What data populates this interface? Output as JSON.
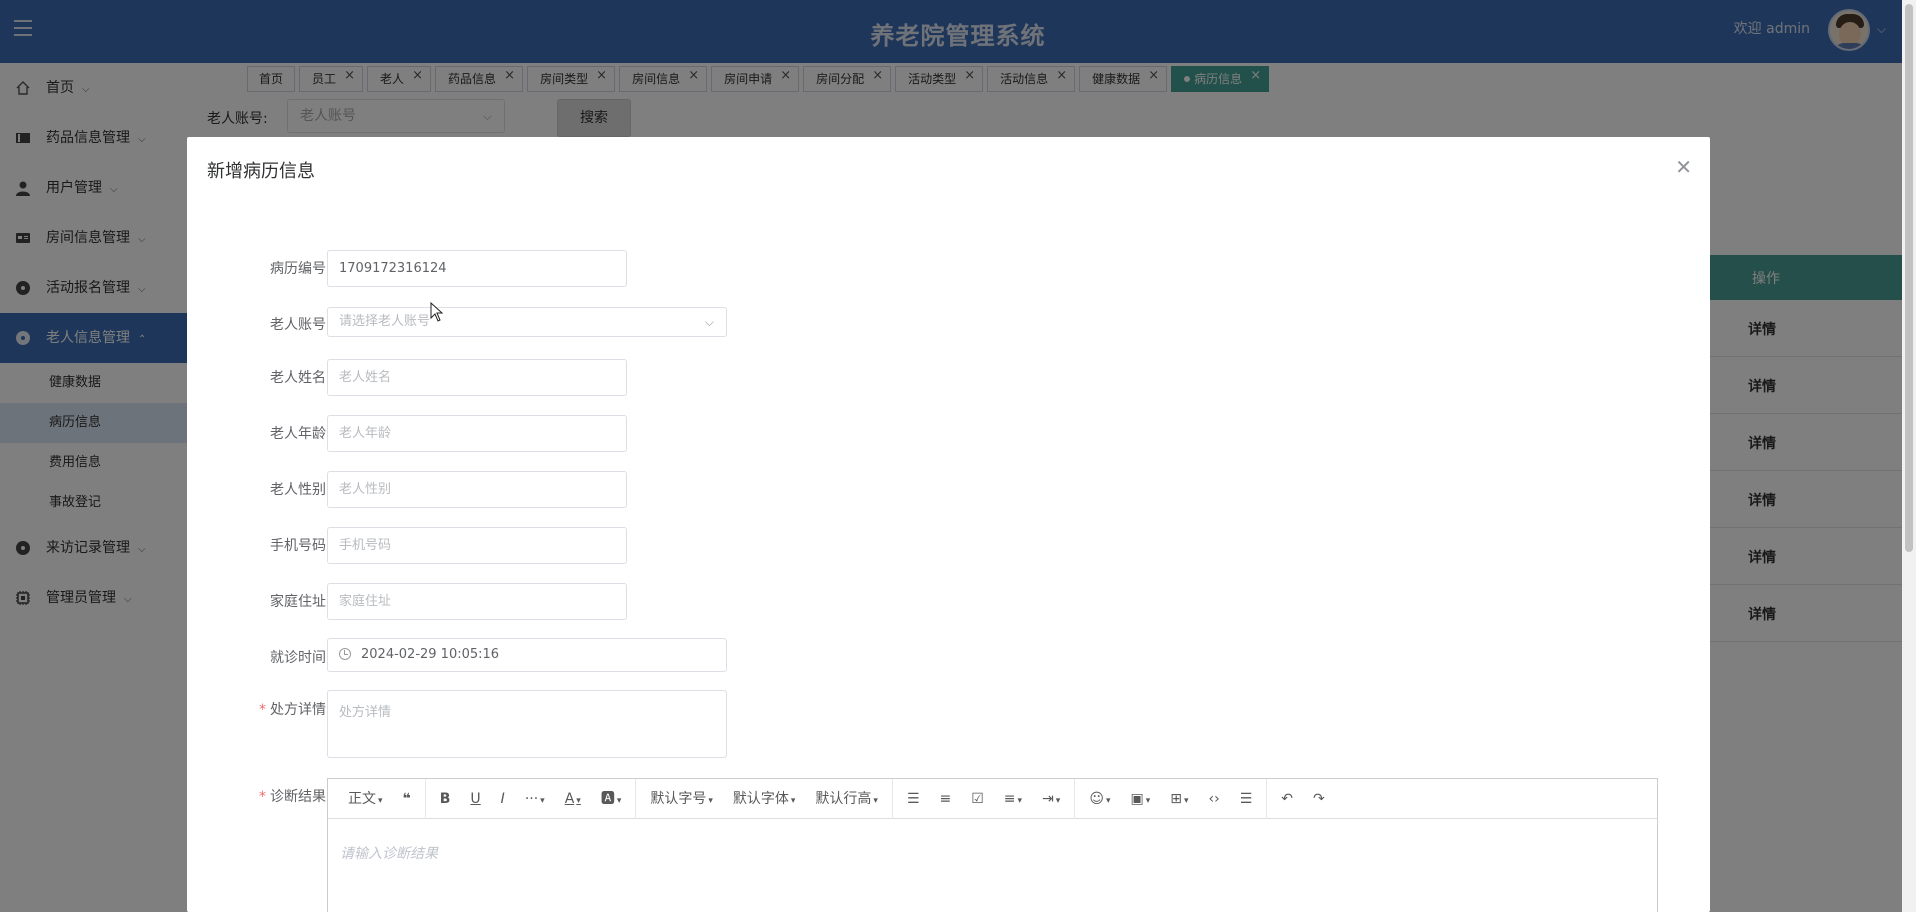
{
  "app": {
    "title": "养老院管理系统",
    "welcome": "欢迎 admin"
  },
  "sidebar": {
    "items": [
      {
        "label": "首页",
        "icon": "home-icon"
      },
      {
        "label": "药品信息管理",
        "icon": "book-icon"
      },
      {
        "label": "用户管理",
        "icon": "user-icon"
      },
      {
        "label": "房间信息管理",
        "icon": "card-icon"
      },
      {
        "label": "活动报名管理",
        "icon": "record-icon"
      },
      {
        "label": "老人信息管理",
        "icon": "record-icon"
      }
    ],
    "sub_items": [
      "健康数据",
      "病历信息",
      "费用信息",
      "事故登记"
    ],
    "items_after": [
      {
        "label": "来访记录管理",
        "icon": "record-icon"
      },
      {
        "label": "管理员管理",
        "icon": "chip-icon"
      }
    ]
  },
  "tabs": [
    "首页",
    "员工",
    "老人",
    "药品信息",
    "房间类型",
    "房间信息",
    "房间申请",
    "房间分配",
    "活动类型",
    "活动信息",
    "健康数据",
    "病历信息"
  ],
  "search": {
    "label": "老人账号:",
    "placeholder": "老人账号",
    "button": "搜索"
  },
  "table": {
    "header_action": "操作",
    "row_action": "详情",
    "rows": 6
  },
  "dialog": {
    "title": "新增病历信息",
    "fields": {
      "record_no": {
        "label": "病历编号",
        "value": "1709172316124"
      },
      "elder_account": {
        "label": "老人账号",
        "placeholder": "请选择老人账号"
      },
      "elder_name": {
        "label": "老人姓名",
        "placeholder": "老人姓名"
      },
      "elder_age": {
        "label": "老人年龄",
        "placeholder": "老人年龄"
      },
      "elder_gender": {
        "label": "老人性别",
        "placeholder": "老人性别"
      },
      "phone": {
        "label": "手机号码",
        "placeholder": "手机号码"
      },
      "address": {
        "label": "家庭住址",
        "placeholder": "家庭住址"
      },
      "visit_time": {
        "label": "就诊时间",
        "value": "2024-02-29 10:05:16"
      },
      "prescription": {
        "label": "处方详情",
        "placeholder": "处方详情"
      },
      "diagnosis": {
        "label": "诊断结果",
        "placeholder": "请输入诊断结果"
      }
    },
    "editor_toolbar": {
      "paragraph": "正文",
      "font_size": "默认字号",
      "font_family": "默认字体",
      "line_height": "默认行高"
    }
  }
}
